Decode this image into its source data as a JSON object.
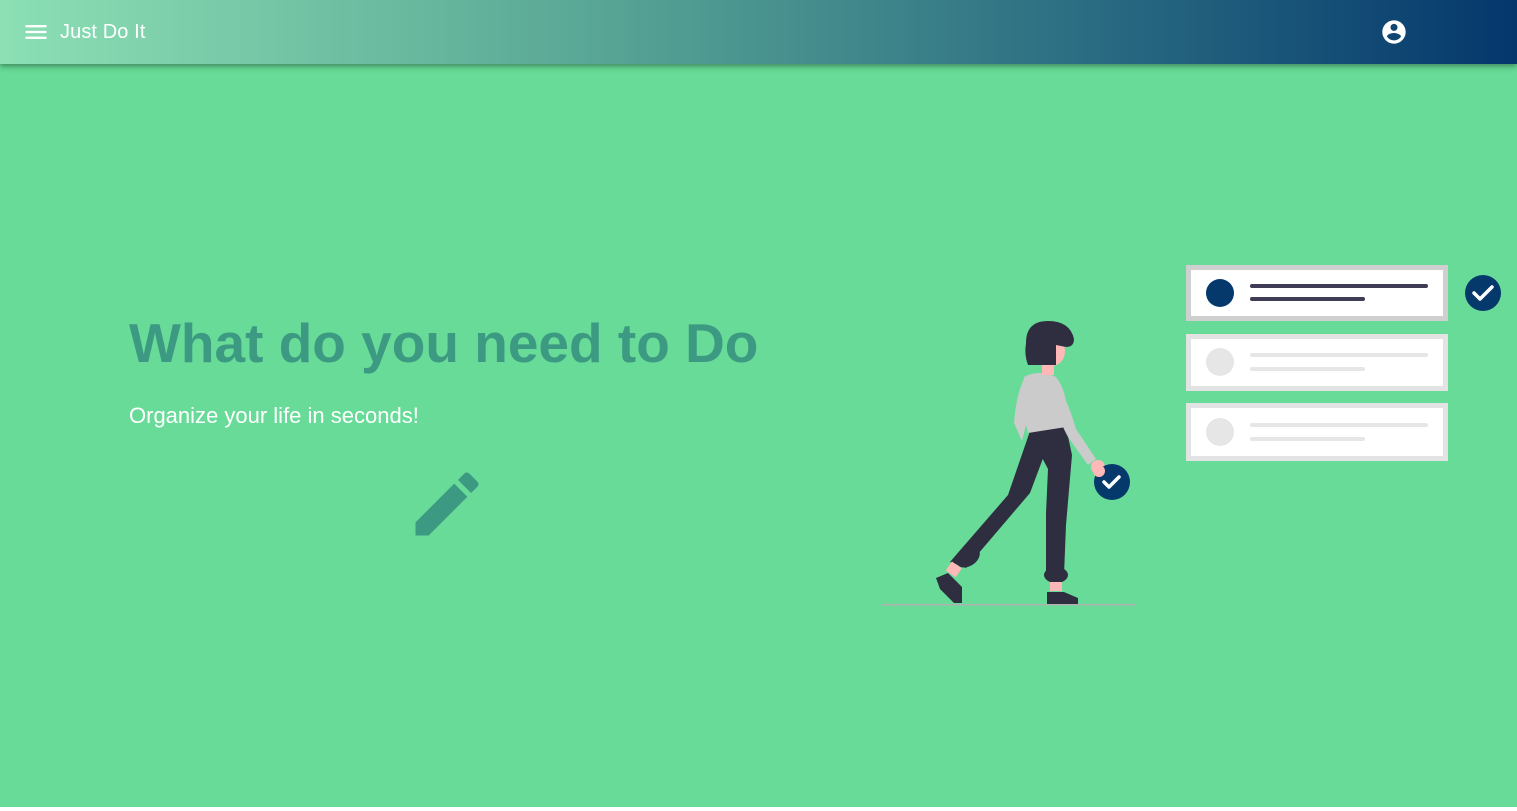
{
  "appbar": {
    "title": "Just Do It",
    "menu_icon": "menu-icon",
    "account_icon": "account-circle-icon"
  },
  "hero": {
    "title": "What do you need to Do",
    "subtitle": "Organize your life in seconds!",
    "action_icon": "pencil-icon"
  },
  "illustration": {
    "subject": "woman-with-checklist",
    "icons": [
      "check-icon"
    ]
  },
  "colors": {
    "background": "#67db97",
    "title_text": "#3d9a82",
    "navy_accent": "#05386b",
    "gradient_start": "#8ce0b4",
    "gradient_end": "#04376c"
  }
}
